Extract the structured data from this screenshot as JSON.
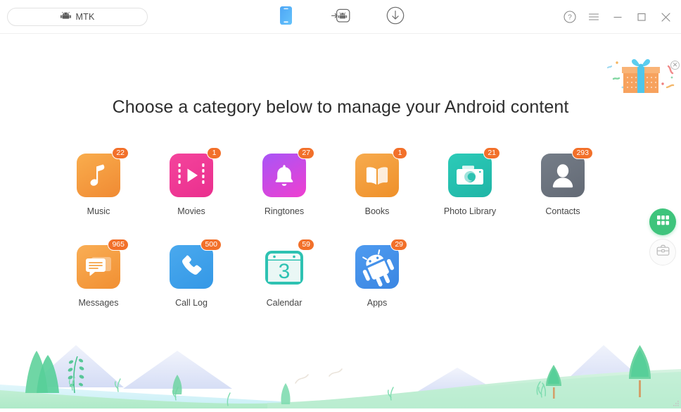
{
  "window": {
    "device_selector": {
      "label": "MTK",
      "icon": "android-head-icon"
    },
    "toolbar": [
      {
        "name": "phone-device-tab",
        "icon": "phone-icon",
        "active": true
      },
      {
        "name": "android-transfer-tab",
        "icon": "android-transfer-icon",
        "active": false
      },
      {
        "name": "download-tab",
        "icon": "download-circle-icon",
        "active": false
      }
    ],
    "controls": [
      {
        "name": "help-button",
        "glyph": "?"
      },
      {
        "name": "menu-button",
        "glyph": "≡"
      },
      {
        "name": "minimize-button",
        "glyph": "−"
      },
      {
        "name": "maximize-button",
        "glyph": "□"
      },
      {
        "name": "close-button",
        "glyph": "✕"
      }
    ]
  },
  "promo": {
    "name": "gift-promo",
    "close_glyph": "✕"
  },
  "main": {
    "headline": "Choose a category below to manage your Android content",
    "rows": [
      [
        {
          "label": "Music",
          "badge": "22",
          "icon": "music-note-icon"
        },
        {
          "label": "Movies",
          "badge": "1",
          "icon": "film-play-icon"
        },
        {
          "label": "Ringtones",
          "badge": "27",
          "icon": "bell-icon"
        },
        {
          "label": "Books",
          "badge": "1",
          "icon": "open-book-icon"
        },
        {
          "label": "Photo Library",
          "badge": "21",
          "icon": "camera-icon"
        },
        {
          "label": "Contacts",
          "badge": "293",
          "icon": "person-icon"
        }
      ],
      [
        {
          "label": "Messages",
          "badge": "965",
          "icon": "message-bubble-icon"
        },
        {
          "label": "Call Log",
          "badge": "500",
          "icon": "phone-handset-icon"
        },
        {
          "label": "Calendar",
          "badge": "59",
          "icon": "calendar-icon",
          "day": "3"
        },
        {
          "label": "Apps",
          "badge": "29",
          "icon": "android-robot-icon"
        }
      ]
    ]
  },
  "rail": [
    {
      "name": "apps-grid-button",
      "icon": "grid-icon",
      "active": true
    },
    {
      "name": "toolbox-button",
      "icon": "toolbox-icon",
      "active": false
    }
  ],
  "colors": {
    "badge": "#f2702a",
    "accent_green": "#3ec47c",
    "music": "#f7a33c",
    "movies": "#ef3f9a",
    "ringtones": "#c23ce8",
    "books": "#f4a03a",
    "photo": "#25bfae",
    "contacts": "#6b737e",
    "messages": "#f6a13c",
    "calllog": "#3fa2ea",
    "calendar": "#26bfae",
    "apps": "#3f92e8"
  }
}
